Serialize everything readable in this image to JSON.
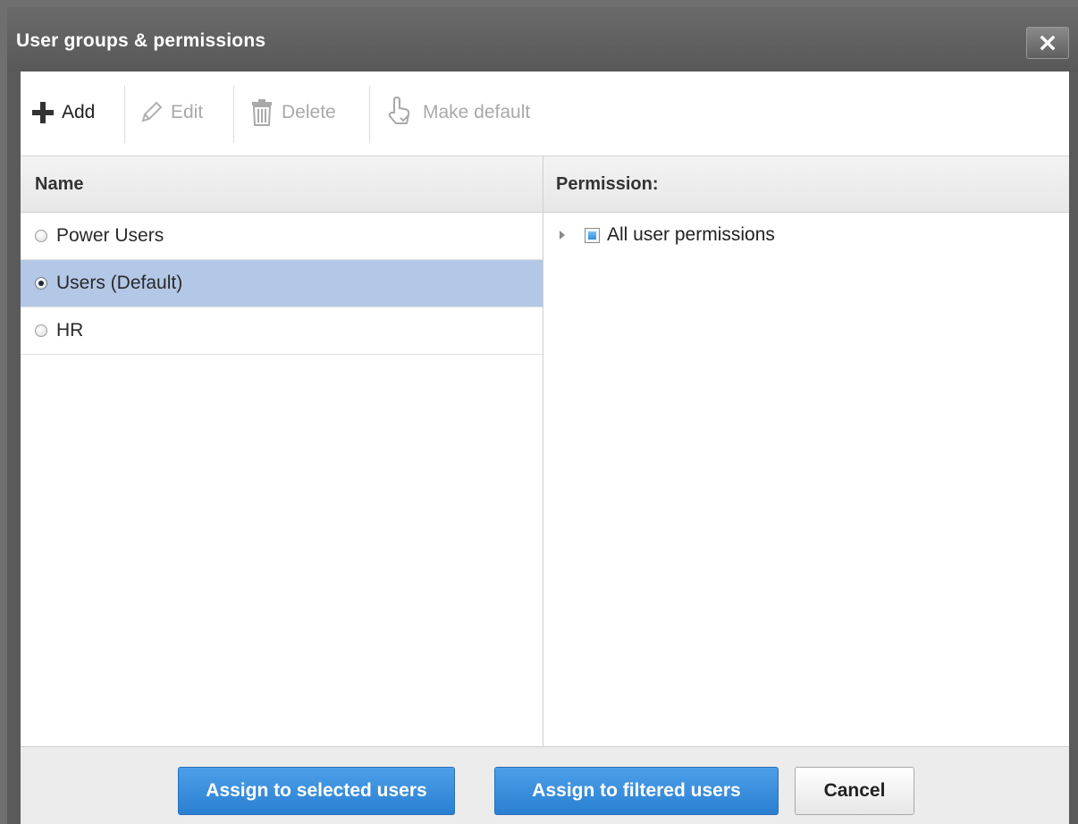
{
  "dialog": {
    "title": "User groups & permissions"
  },
  "toolbar": {
    "add_label": "Add",
    "edit_label": "Edit",
    "delete_label": "Delete",
    "make_default_label": "Make default"
  },
  "groups": {
    "header": "Name",
    "items": [
      {
        "label": "Power Users",
        "selected": false
      },
      {
        "label": "Users (Default)",
        "selected": true
      },
      {
        "label": "HR",
        "selected": false
      }
    ]
  },
  "permissions": {
    "header": "Permission:",
    "tree": [
      {
        "label": "All user permissions",
        "expanded": false,
        "state": "partial"
      }
    ]
  },
  "footer": {
    "assign_selected_label": "Assign to selected users",
    "assign_filtered_label": "Assign to filtered users",
    "cancel_label": "Cancel"
  },
  "colors": {
    "accent": "#2f86d8",
    "selection": "#b3c7e6",
    "titlebar": "#5f5f5f"
  }
}
